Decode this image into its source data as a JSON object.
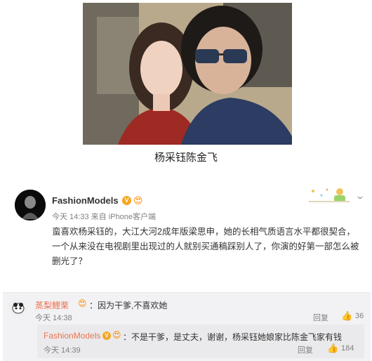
{
  "photo": {
    "caption": "杨采钰陈金飞"
  },
  "post": {
    "username": "FashionModels",
    "verified_badge": "V",
    "vip_icon": "crown-emoji-icon",
    "time": "今天 14:33",
    "source": "来自 iPhone客户端",
    "text": "蛮喜欢杨采钰的，大江大河2成年版梁思申，她的长相气质语言水平都很契合，一个从来没在电视剧里出现过的人就别买通稿踩别人了，你演的好第一部怎么被删光了？",
    "menu_icon": "chevron-down-icon"
  },
  "comments": [
    {
      "username": "蒸梨鲤栗",
      "badge_icon": "crown-emoji-icon",
      "text": "：因为干爹,不喜欢她",
      "time": "今天 14:38",
      "reply_label": "回复",
      "like_count": "36",
      "replies": [
        {
          "username": "FashionModels",
          "verified_badge": "V",
          "badge_icon": "crown-emoji-icon",
          "text": "：不是干爹，是丈夫，谢谢，杨采钰她娘家比陈金飞家有钱",
          "time": "今天 14:39",
          "reply_label": "回复",
          "like_count": "184"
        }
      ]
    }
  ],
  "colors": {
    "username_orange": "#eb7350",
    "meta_gray": "#808080",
    "comment_bg": "#f2f2f5",
    "badge_gold": "#f5a623"
  }
}
